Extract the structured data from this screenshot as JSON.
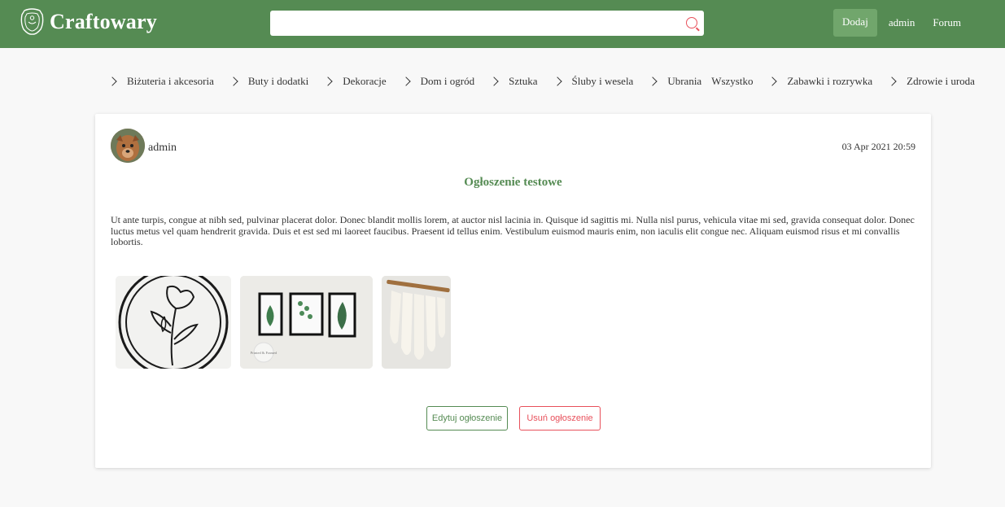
{
  "header": {
    "brand": "Craftowary",
    "search": {
      "value": "",
      "placeholder": ""
    },
    "add_label": "Dodaj",
    "user_label": "admin",
    "forum_label": "Forum"
  },
  "categories": [
    "Biżuteria i akcesoria",
    "Buty i dodatki",
    "Dekoracje",
    "Dom i ogród",
    "Sztuka",
    "Śluby i wesela",
    "Ubrania",
    "Wszystko",
    "Zabawki i rozrywka",
    "Zdrowie i uroda"
  ],
  "post": {
    "author": "admin",
    "date": "03 Apr 2021 20:59",
    "title": "Ogłoszenie testowe",
    "description": "Ut ante turpis, congue at nibh sed, pulvinar placerat dolor. Donec blandit mollis lorem, at auctor nisl lacinia in. Quisque id sagittis mi. Nulla nisl purus, vehicula vitae mi sed, gravida consequat dolor. Donec luctus metus vel quam hendrerit gravida. Duis et est sed mi laoreet faucibus. Praesent id tellus enim. Vestibulum euismod mauris enim, non iaculis elit congue nec. Aliquam euismod risus et mi convallis lobortis.",
    "images": [
      "floral-wire-art",
      "framed-leaf-prints",
      "macrame-wall-hanging"
    ],
    "image2_caption": "Printed & Framed",
    "edit_label": "Edytuj ogłoszenie",
    "delete_label": "Usuń ogłoszenie"
  },
  "colors": {
    "brand": "#558b53",
    "accent": "#71a66c",
    "danger": "#e8505b"
  }
}
